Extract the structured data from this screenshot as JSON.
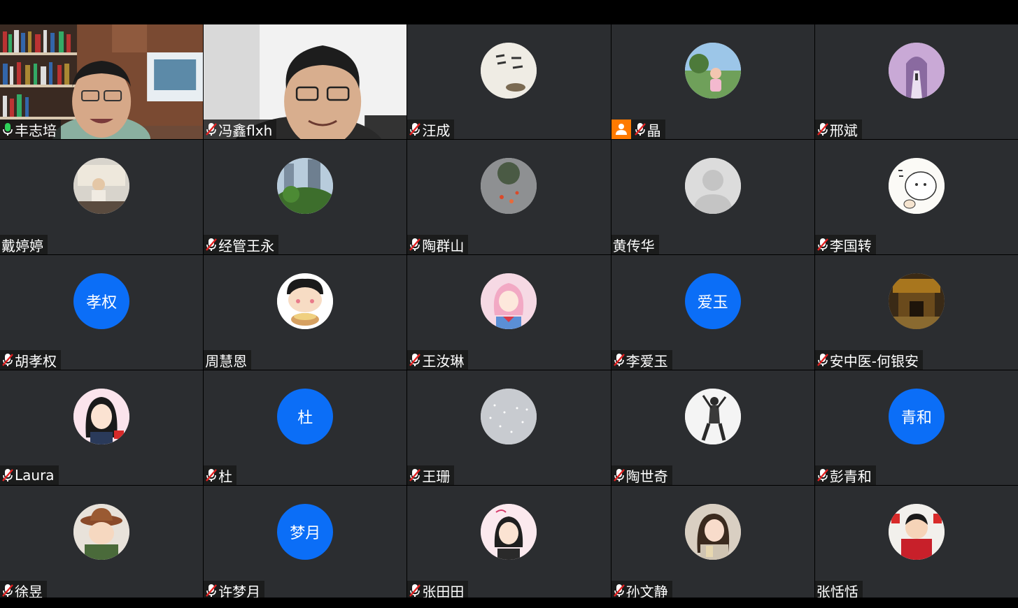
{
  "participants": [
    {
      "name": "丰志培",
      "mic": "on"
    },
    {
      "name": "冯鑫flxh",
      "mic": "muted"
    },
    {
      "name": "汪成",
      "mic": "muted"
    },
    {
      "name": "晶",
      "mic": "muted",
      "host": true
    },
    {
      "name": "邢斌",
      "mic": "muted"
    },
    {
      "name": "戴婷婷",
      "mic": "none"
    },
    {
      "name": "经管王永",
      "mic": "muted"
    },
    {
      "name": "陶群山",
      "mic": "muted"
    },
    {
      "name": "黄传华",
      "mic": "none"
    },
    {
      "name": "李国转",
      "mic": "muted"
    },
    {
      "name": "胡孝权",
      "mic": "muted",
      "initials": "孝权"
    },
    {
      "name": "周慧恩",
      "mic": "none"
    },
    {
      "name": "王汝琳",
      "mic": "muted"
    },
    {
      "name": "李爱玉",
      "mic": "muted",
      "initials": "爱玉"
    },
    {
      "name": "安中医-何银安",
      "mic": "muted"
    },
    {
      "name": "Laura",
      "mic": "muted"
    },
    {
      "name": "杜",
      "mic": "muted",
      "initials": "杜"
    },
    {
      "name": "王珊",
      "mic": "muted"
    },
    {
      "name": "陶世奇",
      "mic": "muted"
    },
    {
      "name": "彭青和",
      "mic": "muted",
      "initials": "青和"
    },
    {
      "name": "徐昱",
      "mic": "muted"
    },
    {
      "name": "许梦月",
      "mic": "muted",
      "initials": "梦月"
    },
    {
      "name": "张田田",
      "mic": "muted"
    },
    {
      "name": "孙文静",
      "mic": "muted"
    },
    {
      "name": "张恬恬",
      "mic": "none"
    }
  ],
  "colors": {
    "tile_bg": "#2b2d30",
    "initials_avatar": "#0b6ef7",
    "active_speaker_border": "#27b14a",
    "host_badge": "#ff7a00",
    "mic_muted": "#e02020"
  }
}
